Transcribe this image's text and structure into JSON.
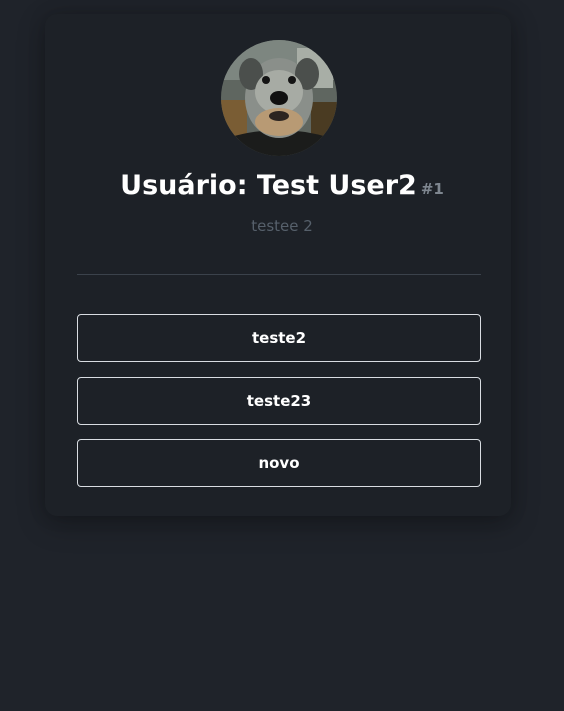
{
  "profile": {
    "title": "Usuário: Test User2",
    "id_badge": "#1",
    "subtitle": "testee 2",
    "avatar_icon": "dog-photo-avatar"
  },
  "items": [
    {
      "label": "teste2"
    },
    {
      "label": "teste23"
    },
    {
      "label": "novo"
    }
  ],
  "colors": {
    "background": "#1f232a",
    "card": "#1d2127",
    "button_border": "#d9dde2",
    "text": "#ffffff",
    "muted": "#56606b"
  }
}
